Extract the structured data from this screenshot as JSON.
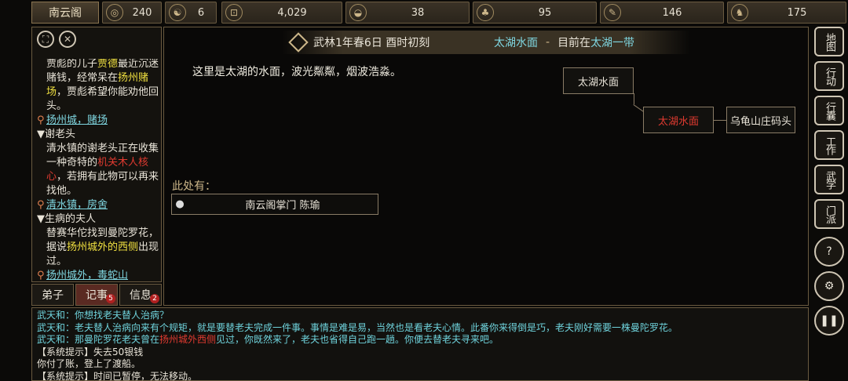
{
  "topbar": {
    "sect": "南云阁",
    "stats": [
      {
        "icon": "coin-pouch-icon",
        "glyph": "◎",
        "value": "240"
      },
      {
        "icon": "yin-yang-icon",
        "glyph": "☯",
        "value": "6"
      },
      {
        "icon": "copper-coin-icon",
        "glyph": "⊡",
        "value": "4,029"
      },
      {
        "icon": "food-bowl-icon",
        "glyph": "◒",
        "value": "38"
      },
      {
        "icon": "herb-icon",
        "glyph": "♣",
        "value": "95"
      },
      {
        "icon": "scroll-icon",
        "glyph": "✎",
        "value": "146"
      },
      {
        "icon": "horse-icon",
        "glyph": "♞",
        "value": "175"
      }
    ]
  },
  "quests": {
    "q1_lines": [
      "贾彪的儿子",
      "贾德",
      "最近沉迷赌钱，经常呆在",
      "扬州赌场",
      "，贾彪希望你能劝他回头。"
    ],
    "q1_loc": "扬州城，赌场",
    "q2_title": "▼谢老头",
    "q2_a": "清水镇的谢老头正在收集一种奇特的",
    "q2_red": "机关木人核心",
    "q2_b": "，若拥有此物可以再来找他。",
    "q2_loc": "清水镇，房舍",
    "q3_title": "▼生病的夫人",
    "q3_a": "替赛华佗找到曼陀罗花，据说",
    "q3_yel": "扬州城外的西侧",
    "q3_b": "出现过。",
    "q3_loc": "扬州城外，毒蛇山"
  },
  "tabs": [
    {
      "label": "弟子",
      "badge": ""
    },
    {
      "label": "记事",
      "badge": "5"
    },
    {
      "label": "信息",
      "badge": "2"
    }
  ],
  "location": {
    "date": "武林1年春6日 酉时初刻",
    "place": "太湖水面",
    "sep": "-",
    "now_prefix": "目前在",
    "now_place": "太湖一带"
  },
  "description": "这里是太湖的水面，波光粼粼，烟波浩淼。",
  "map": {
    "north": "太湖水面",
    "current": "太湖水面",
    "east": "乌龟山庄码头"
  },
  "here": {
    "label": "此处有：",
    "npc": "南云阁掌门 陈瑜"
  },
  "right_menu": [
    "地图",
    "行动",
    "行囊",
    "工作",
    "武学",
    "门派"
  ],
  "log": [
    {
      "speaker": "武天和：",
      "text": "你想找老夫替人治病？",
      "color": "cyan"
    },
    {
      "speaker": "武天和：",
      "text": "老夫替人治病向来有个规矩，就是要替老夫完成一件事。事情是难是易，当然也是看老夫心情。此番你来得倒是巧，老夫刚好需要一株曼陀罗花。",
      "color": "cyan"
    },
    {
      "speaker": "武天和：",
      "text_a": "那曼陀罗花老夫曾在",
      "text_red": "扬州城外西侧",
      "text_b": "见过，你既然来了，老夫也省得自己跑一趟。你便去替老夫寻来吧。",
      "color": "cyan"
    },
    {
      "text": "【系统提示】失去50银钱",
      "color": "white"
    },
    {
      "text": "你付了账，登上了渡船。",
      "color": "white"
    },
    {
      "text": "【系统提示】时间已暂停，无法移动。",
      "color": "white"
    }
  ]
}
